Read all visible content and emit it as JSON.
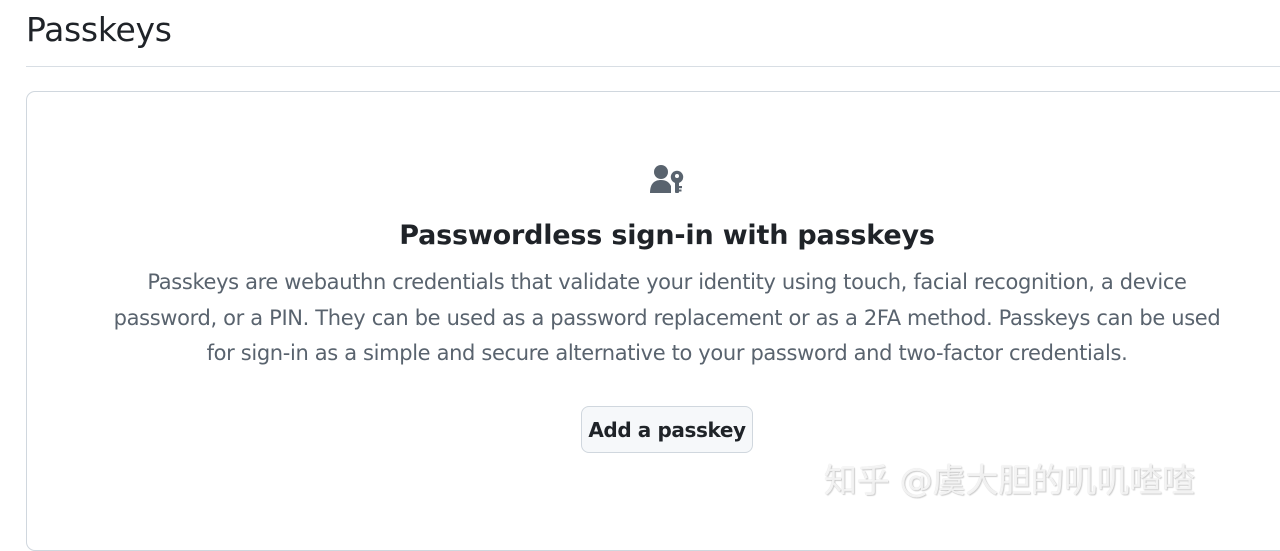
{
  "page": {
    "title": "Passkeys"
  },
  "empty_state": {
    "icon": "passkey-icon",
    "heading": "Passwordless sign-in with passkeys",
    "description": "Passkeys are webauthn credentials that validate your identity using touch, facial recognition, a device password, or a PIN. They can be used as a password replacement or as a 2FA method. Passkeys can be used for sign-in as a simple and secure alternative to your password and two-factor credentials.",
    "button_label": "Add a passkey"
  },
  "watermark": {
    "text": "知乎 @虞大胆的叽叽喳喳"
  },
  "colors": {
    "text": "#1f2328",
    "muted_text": "#59636e",
    "border": "#d0d7de",
    "button_background": "#f6f8fa",
    "icon": "#59636e"
  }
}
